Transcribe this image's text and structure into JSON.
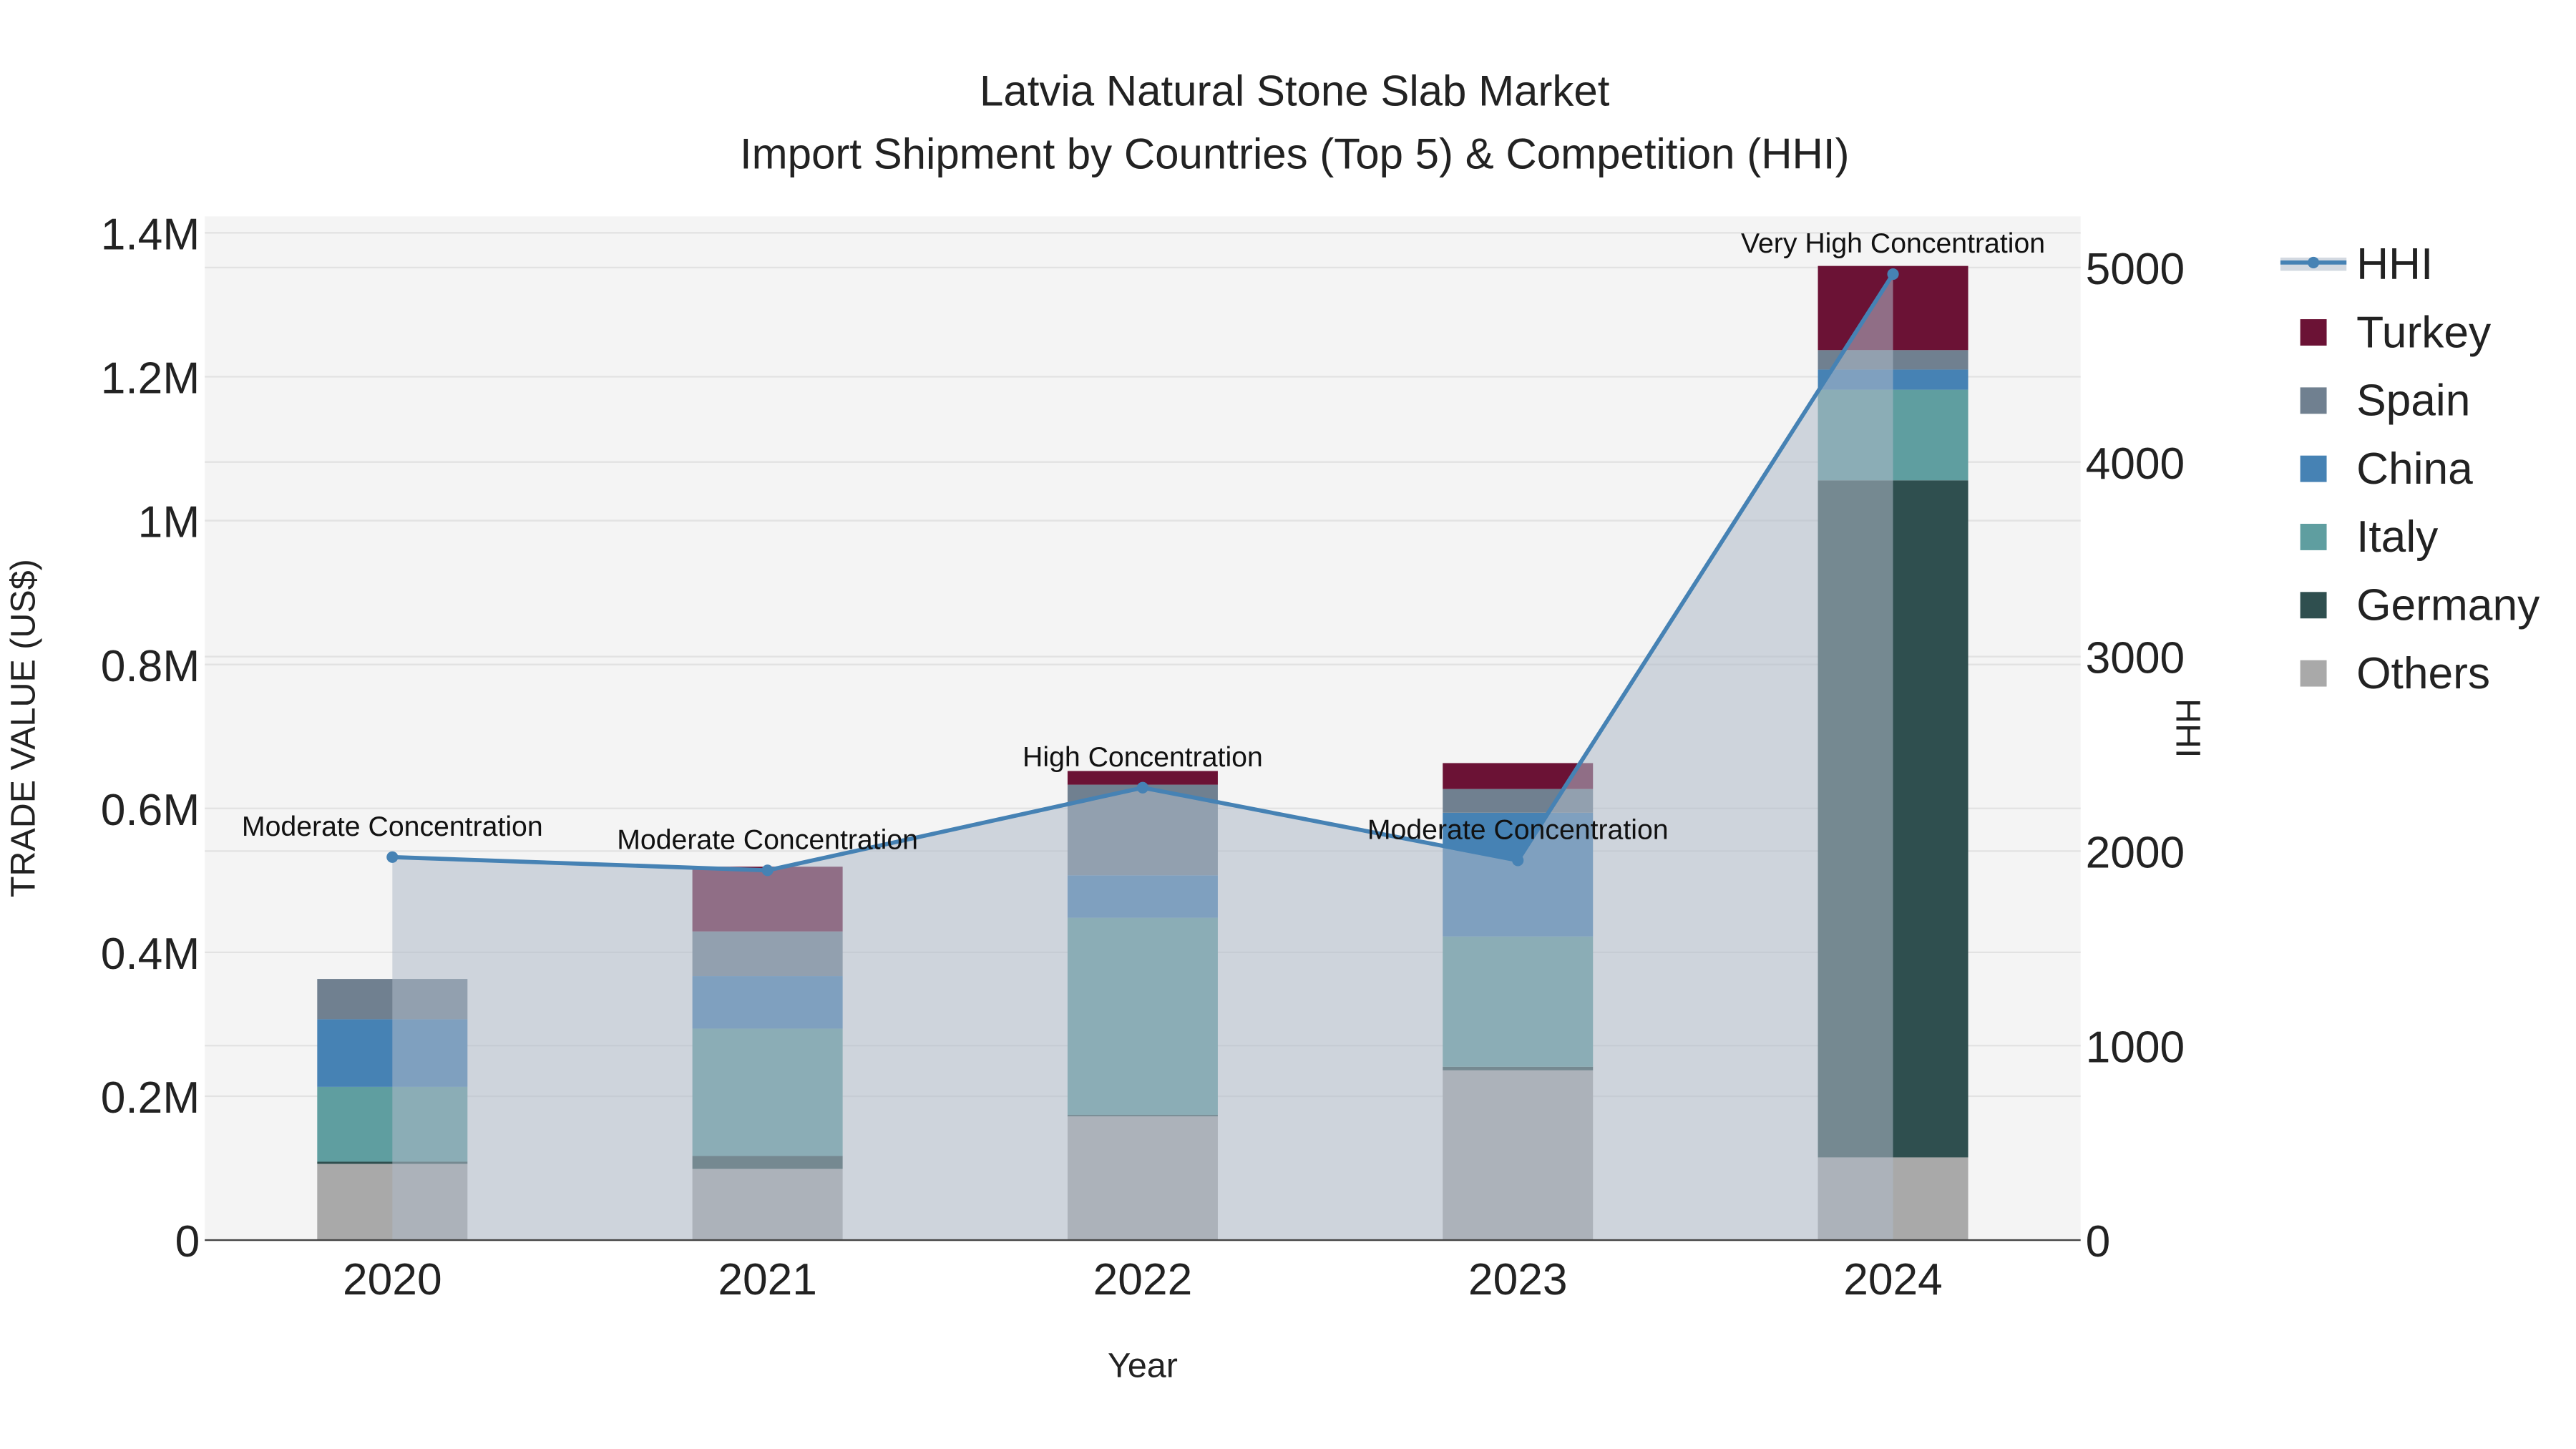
{
  "chart_data": {
    "type": "bar",
    "stacked": true,
    "title": "Latvia Natural Stone Slab Market",
    "subtitle": "Import Shipment by Countries (Top 5) & Competition (HHI)",
    "xlabel": "Year",
    "ylabel": "TRADE VALUE (US$)",
    "y2label": "HHI",
    "categories": [
      "2020",
      "2021",
      "2022",
      "2023",
      "2024"
    ],
    "ylim": [
      0,
      1400000
    ],
    "y2lim": [
      0,
      5200
    ],
    "yticks": [
      {
        "v": 0,
        "label": "0"
      },
      {
        "v": 200000,
        "label": "0.2M"
      },
      {
        "v": 400000,
        "label": "0.4M"
      },
      {
        "v": 600000,
        "label": "0.6M"
      },
      {
        "v": 800000,
        "label": "0.8M"
      },
      {
        "v": 1000000,
        "label": "1M"
      },
      {
        "v": 1200000,
        "label": "1.2M"
      },
      {
        "v": 1400000,
        "label": "1.4M"
      }
    ],
    "y2ticks": [
      {
        "v": 0,
        "label": "0"
      },
      {
        "v": 1000,
        "label": "1000"
      },
      {
        "v": 2000,
        "label": "2000"
      },
      {
        "v": 3000,
        "label": "3000"
      },
      {
        "v": 4000,
        "label": "4000"
      },
      {
        "v": 5000,
        "label": "5000"
      }
    ],
    "series": [
      {
        "name": "Others",
        "color": "#a9a9a9",
        "values": [
          106000,
          99000,
          172000,
          236000,
          115000
        ]
      },
      {
        "name": "Germany",
        "color": "#2f4f4f",
        "values": [
          3000,
          18000,
          2000,
          5000,
          941000
        ]
      },
      {
        "name": "Italy",
        "color": "#5f9ea0",
        "values": [
          104000,
          177000,
          274000,
          181000,
          126000
        ]
      },
      {
        "name": "China",
        "color": "#4682b4",
        "values": [
          94000,
          73000,
          59000,
          172000,
          28000
        ]
      },
      {
        "name": "Spain",
        "color": "#708090",
        "values": [
          56000,
          62000,
          126000,
          33000,
          27000
        ]
      },
      {
        "name": "Turkey",
        "color": "#6b1235",
        "values": [
          0,
          90000,
          19000,
          36000,
          117000
        ]
      }
    ],
    "line": {
      "name": "HHI",
      "color": "#4682b4",
      "values": [
        1969,
        1901,
        2326,
        1952,
        4966
      ],
      "annotations": [
        "Moderate Concentration",
        "Moderate Concentration",
        "High Concentration",
        "Moderate Concentration",
        "Very High Concentration"
      ]
    },
    "legend_order": [
      "HHI",
      "Turkey",
      "Spain",
      "China",
      "Italy",
      "Germany",
      "Others"
    ],
    "legend_position": "right",
    "grid": true
  }
}
